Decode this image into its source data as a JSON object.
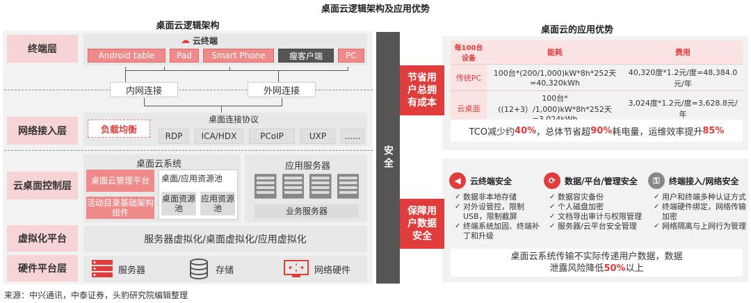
{
  "title": "桌面云逻辑架构及应用优势",
  "left": {
    "title": "桌面云逻辑架构",
    "layers": [
      "终端层",
      "网络接入层",
      "云桌面控制层",
      "虚拟化平台",
      "硬件平台层"
    ],
    "cloud_terminal": "云终端",
    "devices": [
      "Android table",
      "Pad",
      "Smart Phone",
      "瘦客户端",
      "PC"
    ],
    "connections": [
      "内网连接",
      "外网连接"
    ],
    "protocol_title": "桌面连接协议",
    "load_balance": "负载均衡",
    "protocols": [
      "RDP",
      "ICA/HDX",
      "PCoIP",
      "UXP",
      "......"
    ],
    "cloud_system_title": "桌面云系统",
    "mgmt_platform": "桌面云管理平台",
    "ad_component": "活动目录基础架构组件",
    "pool_title": "桌面/应用资源池",
    "desktop_pool": "桌面资源池",
    "app_pool": "应用资源池",
    "app_server_title": "应用服务器",
    "business_server": "业务服务器",
    "virtualization": "服务器虚拟化/桌面虚拟化/应用虚拟化",
    "hardware": [
      "服务器",
      "存储",
      "网络硬件"
    ]
  },
  "security": "安全",
  "right": {
    "title": "桌面云的应用优势",
    "cost_tag": "节省用户总拥有成本",
    "table_headers": [
      "每100台设备",
      "能耗",
      "费用"
    ],
    "table_rows": [
      {
        "device": "传统PC",
        "energy": "100台*(200/1,000)kW*8h*252天=40,320kWh",
        "cost": "40,320度*1.2元/度=48,384.0元/年"
      },
      {
        "device": "云桌面",
        "energy": "100台*((12+3）/1,000)kW*8h*252天=3,024kWh",
        "cost": "3,024度*1.2元/度=3,628.8元/年"
      }
    ],
    "tco_parts": [
      "TCO减少约",
      "40%",
      "，总体节省超",
      "90%",
      "耗电量，运维效率提升",
      "85%"
    ],
    "safety_tag": "保障用户数据安全",
    "sec_groups": [
      {
        "title": "云终端安全",
        "items": [
          "数据非本地存储",
          "对外设管控，限制USB，限制截屏",
          "终端系统加固、终端补丁和升级"
        ]
      },
      {
        "title": "数据/平台/管理安全",
        "items": [
          "数据容灾备份",
          "个人磁盘加密",
          "文档导出审计与权限管理",
          "服务器/云平台安全管理"
        ]
      },
      {
        "title": "终端接入/网络安全",
        "items": [
          "用户和终端多种认证方式",
          "终端硬件绑定，网络传输加密",
          "网络隔离与上网行为管理"
        ]
      }
    ],
    "risk_line1": "桌面云系统传输不实际传递用户数据，数据",
    "risk_line2_parts": [
      "泄露风险降低",
      "50%",
      "以上"
    ]
  },
  "source": "来源：中兴通讯，中泰证券，头豹研究院编辑整理",
  "colors": {
    "accent_red": "#e03c3c",
    "pink": "#f6d4d6",
    "dark_gray": "#555555"
  }
}
